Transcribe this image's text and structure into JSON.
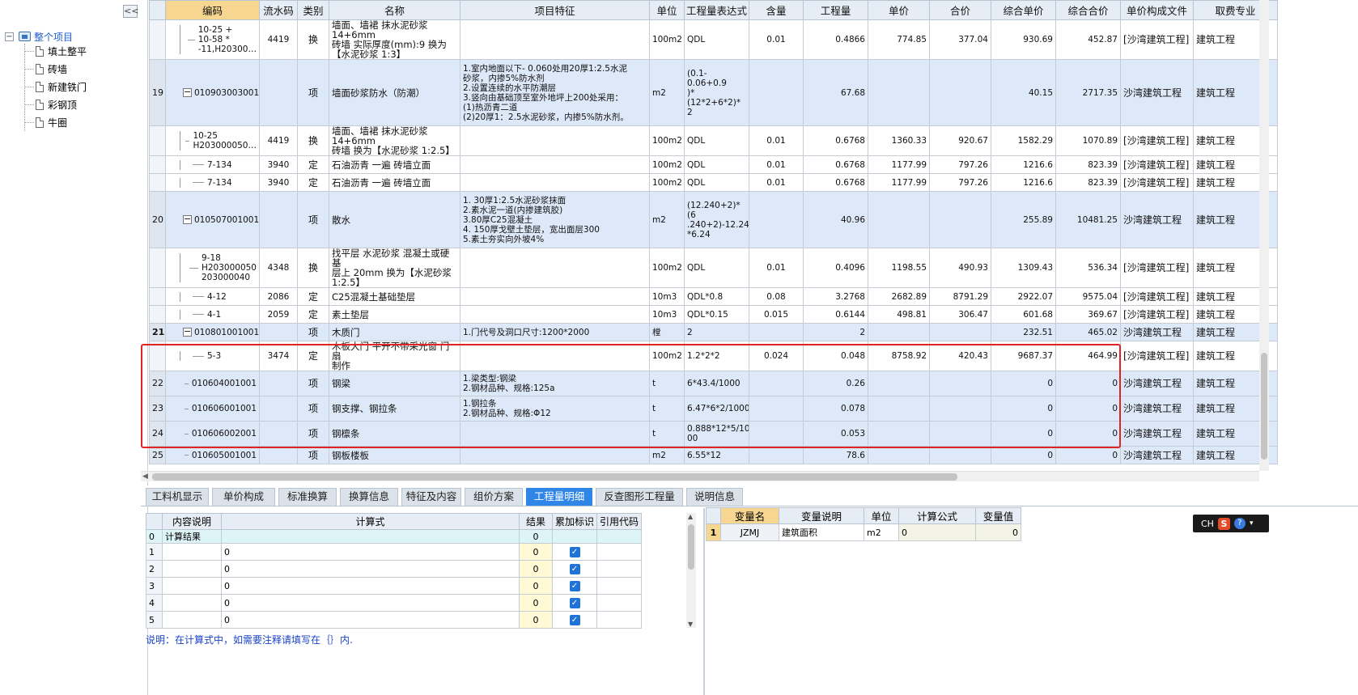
{
  "sidebar": {
    "collapse_label": "<<",
    "root_label": "整个项目",
    "items": [
      "填土整平",
      "砖墙",
      "新建铁门",
      "彩钢顶",
      "牛圈"
    ]
  },
  "grid": {
    "headers": [
      "编码",
      "流水码",
      "类别",
      "名称",
      "项目特征",
      "单位",
      "工程量表达式",
      "含量",
      "工程量",
      "单价",
      "合价",
      "综合单价",
      "综合合价",
      "单价构成文件",
      "取费专业"
    ],
    "rows": [
      {
        "kind": "sub",
        "no": "",
        "code": "10-25 +\n10-58 *\n-11,H20300…",
        "flow": "4419",
        "cat": "换",
        "name": "墙面、墙裙 抹水泥砂浆 14+6mm\n砖墙  实际厚度(mm):9  换为\n【水泥砂浆 1:3】",
        "feature": "",
        "unit": "100m2",
        "expr": "QDL",
        "content": "0.01",
        "qty": "0.4866",
        "price": "774.85",
        "total": "377.04",
        "cu": "930.69",
        "ct": "452.87",
        "file": "[沙湾建筑工程]",
        "spec": "建筑工程"
      },
      {
        "kind": "item",
        "no": "19",
        "code": "010903003001",
        "flow": "",
        "cat": "项",
        "name": "墙面砂浆防水（防潮）",
        "feature": "1.室内地面以下- 0.060处用20厚1:2.5水泥\n砂浆，内掺5%防水剂\n2.设置连续的水平防潮层\n3.竖向由基础顶至室外地坪上200处采用：\n(1)热沥青二道\n(2)20厚1：2.5水泥砂浆，内掺5%防水剂。",
        "unit": "m2",
        "expr": "(0.1-0.06+0.9\n)*(12*2+6*2)*\n2",
        "content": "",
        "qty": "67.68",
        "price": "",
        "total": "",
        "cu": "40.15",
        "ct": "2717.35",
        "file": "沙湾建筑工程",
        "spec": "建筑工程"
      },
      {
        "kind": "sub",
        "no": "",
        "code": "10-25\nH203000050…",
        "flow": "4419",
        "cat": "换",
        "name": "墙面、墙裙 抹水泥砂浆 14+6mm\n砖墙  换为【水泥砂浆 1:2.5】",
        "feature": "",
        "unit": "100m2",
        "expr": "QDL",
        "content": "0.01",
        "qty": "0.6768",
        "price": "1360.33",
        "total": "920.67",
        "cu": "1582.29",
        "ct": "1070.89",
        "file": "[沙湾建筑工程]",
        "spec": "建筑工程"
      },
      {
        "kind": "sub",
        "no": "",
        "code": "7-134",
        "flow": "3940",
        "cat": "定",
        "name": "石油沥青 一遍 砖墙立面",
        "feature": "",
        "unit": "100m2",
        "expr": "QDL",
        "content": "0.01",
        "qty": "0.6768",
        "price": "1177.99",
        "total": "797.26",
        "cu": "1216.6",
        "ct": "823.39",
        "file": "[沙湾建筑工程]",
        "spec": "建筑工程"
      },
      {
        "kind": "sub",
        "no": "",
        "code": "7-134",
        "flow": "3940",
        "cat": "定",
        "name": "石油沥青 一遍 砖墙立面",
        "feature": "",
        "unit": "100m2",
        "expr": "QDL",
        "content": "0.01",
        "qty": "0.6768",
        "price": "1177.99",
        "total": "797.26",
        "cu": "1216.6",
        "ct": "823.39",
        "file": "[沙湾建筑工程]",
        "spec": "建筑工程"
      },
      {
        "kind": "item",
        "no": "20",
        "code": "010507001001",
        "flow": "",
        "cat": "项",
        "name": "散水",
        "feature": "1. 30厚1:2.5水泥砂浆抹面\n2.素水泥一道(内掺建筑胶)\n3.80厚C25混凝土\n4. 150厚戈壁土垫层，宽出面层300\n5.素土夯实向外坡4%",
        "unit": "m2",
        "expr": "(12.240+2)*(6\n.240+2)-12.24\n*6.24",
        "content": "",
        "qty": "40.96",
        "price": "",
        "total": "",
        "cu": "255.89",
        "ct": "10481.25",
        "file": "沙湾建筑工程",
        "spec": "建筑工程"
      },
      {
        "kind": "sub",
        "no": "",
        "code": "9-18\nH203000050\n203000040",
        "flow": "4348",
        "cat": "换",
        "name": "找平层 水泥砂浆 混凝土或硬基\n层上 20mm  换为【水泥砂浆\n1:2.5】",
        "feature": "",
        "unit": "100m2",
        "expr": "QDL",
        "content": "0.01",
        "qty": "0.4096",
        "price": "1198.55",
        "total": "490.93",
        "cu": "1309.43",
        "ct": "536.34",
        "file": "[沙湾建筑工程]",
        "spec": "建筑工程"
      },
      {
        "kind": "sub",
        "no": "",
        "code": "4-12",
        "flow": "2086",
        "cat": "定",
        "name": "C25混凝土基础垫层",
        "feature": "",
        "unit": "10m3",
        "expr": "QDL*0.8",
        "content": "0.08",
        "qty": "3.2768",
        "price": "2682.89",
        "total": "8791.29",
        "cu": "2922.07",
        "ct": "9575.04",
        "file": "[沙湾建筑工程]",
        "spec": "建筑工程"
      },
      {
        "kind": "sub",
        "no": "",
        "code": "4-1",
        "flow": "2059",
        "cat": "定",
        "name": "素土垫层",
        "feature": "",
        "unit": "10m3",
        "expr": "QDL*0.15",
        "content": "0.015",
        "qty": "0.6144",
        "price": "498.81",
        "total": "306.47",
        "cu": "601.68",
        "ct": "369.67",
        "file": "[沙湾建筑工程]",
        "spec": "建筑工程"
      },
      {
        "kind": "item sel",
        "no": "21",
        "code": "010801001001",
        "flow": "",
        "cat": "项",
        "name": "木质门",
        "feature": "1.门代号及洞口尺寸:1200*2000",
        "unit": "樘",
        "expr": "2",
        "content": "",
        "qty": "2",
        "price": "",
        "total": "",
        "cu": "232.51",
        "ct": "465.02",
        "file": "沙湾建筑工程",
        "spec": "建筑工程"
      },
      {
        "kind": "sub",
        "no": "",
        "code": "5-3",
        "flow": "3474",
        "cat": "定",
        "name": "木板大门 平开不带采光窗 门扇\n制作",
        "feature": "",
        "unit": "100m2",
        "expr": "1.2*2*2",
        "content": "0.024",
        "qty": "0.048",
        "price": "8758.92",
        "total": "420.43",
        "cu": "9687.37",
        "ct": "464.99",
        "file": "[沙湾建筑工程]",
        "spec": "建筑工程"
      },
      {
        "kind": "item",
        "no": "22",
        "code": "010604001001",
        "flow": "",
        "cat": "项",
        "name": "钢梁",
        "feature": "1.梁类型:钢梁\n2.钢材品种、规格:125a",
        "unit": "t",
        "expr": "6*43.4/1000",
        "content": "",
        "qty": "0.26",
        "price": "",
        "total": "",
        "cu": "0",
        "ct": "0",
        "file": "沙湾建筑工程",
        "spec": "建筑工程"
      },
      {
        "kind": "item",
        "no": "23",
        "code": "010606001001",
        "flow": "",
        "cat": "项",
        "name": "钢支撑、钢拉条",
        "feature": "1.钢拉条\n2.钢材品种、规格:Φ12",
        "unit": "t",
        "expr": "6.47*6*2/1000",
        "content": "",
        "qty": "0.078",
        "price": "",
        "total": "",
        "cu": "0",
        "ct": "0",
        "file": "沙湾建筑工程",
        "spec": "建筑工程"
      },
      {
        "kind": "item",
        "no": "24",
        "code": "010606002001",
        "flow": "",
        "cat": "项",
        "name": "钢檩条",
        "feature": "",
        "unit": "t",
        "expr": "0.888*12*5/10\n00",
        "content": "",
        "qty": "0.053",
        "price": "",
        "total": "",
        "cu": "0",
        "ct": "0",
        "file": "沙湾建筑工程",
        "spec": "建筑工程"
      },
      {
        "kind": "item",
        "no": "25",
        "code": "010605001001",
        "flow": "",
        "cat": "项",
        "name": "钢板楼板",
        "feature": "",
        "unit": "m2",
        "expr": "6.55*12",
        "content": "",
        "qty": "78.6",
        "price": "",
        "total": "",
        "cu": "0",
        "ct": "0",
        "file": "沙湾建筑工程",
        "spec": "建筑工程"
      }
    ]
  },
  "tabs": [
    "工料机显示",
    "单价构成",
    "标准换算",
    "换算信息",
    "特征及内容",
    "组价方案",
    "工程量明细",
    "反查图形工程量",
    "说明信息"
  ],
  "active_tab": "工程量明细",
  "detail": {
    "headers": [
      "内容说明",
      "计算式",
      "结果",
      "累加标识",
      "引用代码"
    ],
    "result_row": {
      "no": "0",
      "label": "计算结果",
      "value": "0"
    },
    "rows": [
      {
        "no": "1",
        "expr": "0",
        "value": "0"
      },
      {
        "no": "2",
        "expr": "0",
        "value": "0"
      },
      {
        "no": "3",
        "expr": "0",
        "value": "0"
      },
      {
        "no": "4",
        "expr": "0",
        "value": "0"
      },
      {
        "no": "5",
        "expr": "0",
        "value": "0"
      }
    ],
    "check_glyph": "✓",
    "note": "说明：在计算式中，如需要注释请填写在｛｝内."
  },
  "variables": {
    "headers": [
      "变量名",
      "变量说明",
      "单位",
      "计算公式",
      "变量值"
    ],
    "rows": [
      {
        "no": "1",
        "name": "JZMJ",
        "desc": "建筑面积",
        "unit": "m2",
        "formula": "0",
        "value": "0"
      }
    ]
  },
  "ime": {
    "label": "CH",
    "s_glyph": "S",
    "help_glyph": "?",
    "dropdown_glyph": "▾"
  }
}
